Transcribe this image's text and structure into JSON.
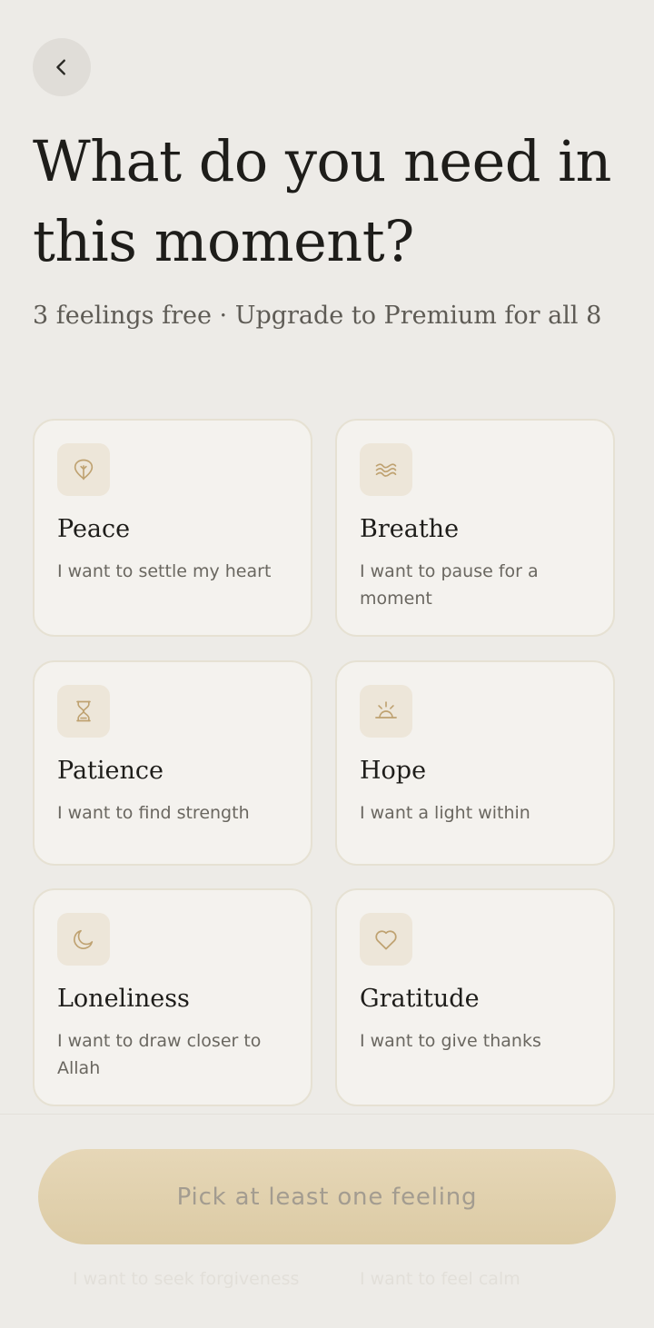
{
  "header": {
    "back_icon": "chevron-left-icon",
    "title": "What do you need in this moment?",
    "subtitle": "3 feelings free · Upgrade to Premium for all 8"
  },
  "colors": {
    "background": "#EDEBE7",
    "card_background": "#F4F2EE",
    "card_border": "#E6E1D3",
    "icon_tile": "#EDE6D9",
    "icon_stroke": "#BFA271",
    "button": "#E2D3B2",
    "button_text": "#A39C90"
  },
  "feelings": [
    {
      "name": "Peace",
      "description": "I want to settle my heart",
      "icon": "leaf-icon"
    },
    {
      "name": "Breathe",
      "description": "I want to pause for a moment",
      "icon": "wind-waves-icon"
    },
    {
      "name": "Patience",
      "description": "I want to find strength",
      "icon": "hourglass-icon"
    },
    {
      "name": "Hope",
      "description": "I want a light within",
      "icon": "sunrise-icon"
    },
    {
      "name": "Loneliness",
      "description": "I want to draw closer to Allah",
      "icon": "crescent-moon-icon"
    },
    {
      "name": "Gratitude",
      "description": "I want to give thanks",
      "icon": "heart-icon"
    }
  ],
  "footer": {
    "button_label": "Pick at least one feeling",
    "ghost_left": "I want to seek forgiveness",
    "ghost_right": "I want to feel calm"
  }
}
